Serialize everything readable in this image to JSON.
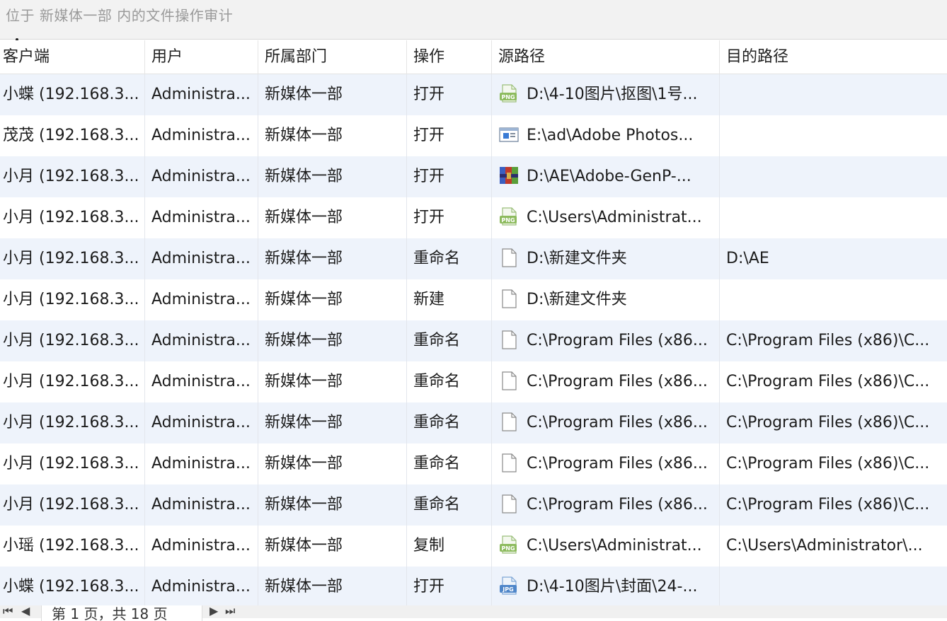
{
  "window": {
    "title": "位于 新媒体一部 内的文件操作审计"
  },
  "columns": [
    "客户端",
    "用户",
    "所属部门",
    "操作",
    "源路径",
    "目的路径"
  ],
  "rows": [
    {
      "client": "小蝶 (192.168.3...",
      "user": "Administra...",
      "dept": "新媒体一部",
      "op": "打开",
      "icon": "png-file-icon",
      "src": "D:\\4-10图片\\抠图\\1号...",
      "dst": ""
    },
    {
      "client": "茂茂 (192.168.3...",
      "user": "Administra...",
      "dept": "新媒体一部",
      "op": "打开",
      "icon": "application-window-icon",
      "src": "E:\\ad\\Adobe Photos...",
      "dst": ""
    },
    {
      "client": "小月 (192.168.3...",
      "user": "Administra...",
      "dept": "新媒体一部",
      "op": "打开",
      "icon": "archive-file-icon",
      "src": "D:\\AE\\Adobe-GenP-...",
      "dst": ""
    },
    {
      "client": "小月 (192.168.3...",
      "user": "Administra...",
      "dept": "新媒体一部",
      "op": "打开",
      "icon": "png-file-icon",
      "src": "C:\\Users\\Administrat...",
      "dst": ""
    },
    {
      "client": "小月 (192.168.3...",
      "user": "Administra...",
      "dept": "新媒体一部",
      "op": "重命名",
      "icon": "blank-file-icon",
      "src": "D:\\新建文件夹",
      "dst": "D:\\AE"
    },
    {
      "client": "小月 (192.168.3...",
      "user": "Administra...",
      "dept": "新媒体一部",
      "op": "新建",
      "icon": "blank-file-icon",
      "src": "D:\\新建文件夹",
      "dst": ""
    },
    {
      "client": "小月 (192.168.3...",
      "user": "Administra...",
      "dept": "新媒体一部",
      "op": "重命名",
      "icon": "blank-file-icon",
      "src": "C:\\Program Files (x86...",
      "dst": "C:\\Program Files (x86)\\C..."
    },
    {
      "client": "小月 (192.168.3...",
      "user": "Administra...",
      "dept": "新媒体一部",
      "op": "重命名",
      "icon": "blank-file-icon",
      "src": "C:\\Program Files (x86...",
      "dst": "C:\\Program Files (x86)\\C..."
    },
    {
      "client": "小月 (192.168.3...",
      "user": "Administra...",
      "dept": "新媒体一部",
      "op": "重命名",
      "icon": "blank-file-icon",
      "src": "C:\\Program Files (x86...",
      "dst": "C:\\Program Files (x86)\\C..."
    },
    {
      "client": "小月 (192.168.3...",
      "user": "Administra...",
      "dept": "新媒体一部",
      "op": "重命名",
      "icon": "blank-file-icon",
      "src": "C:\\Program Files (x86...",
      "dst": "C:\\Program Files (x86)\\C..."
    },
    {
      "client": "小月 (192.168.3...",
      "user": "Administra...",
      "dept": "新媒体一部",
      "op": "重命名",
      "icon": "blank-file-icon",
      "src": "C:\\Program Files (x86...",
      "dst": "C:\\Program Files (x86)\\C..."
    },
    {
      "client": "小瑶 (192.168.3...",
      "user": "Administra...",
      "dept": "新媒体一部",
      "op": "复制",
      "icon": "png-file-icon",
      "src": "C:\\Users\\Administrat...",
      "dst": "C:\\Users\\Administrator\\..."
    },
    {
      "client": "小蝶 (192.168.3...",
      "user": "Administra...",
      "dept": "新媒体一部",
      "op": "打开",
      "icon": "jpg-file-icon",
      "src": "D:\\4-10图片\\封面\\24-...",
      "dst": ""
    }
  ],
  "pager": {
    "first": "⏮",
    "prev": "◀",
    "info": "第 1 页，共 18 页",
    "next": "▶",
    "last": "⏭"
  }
}
